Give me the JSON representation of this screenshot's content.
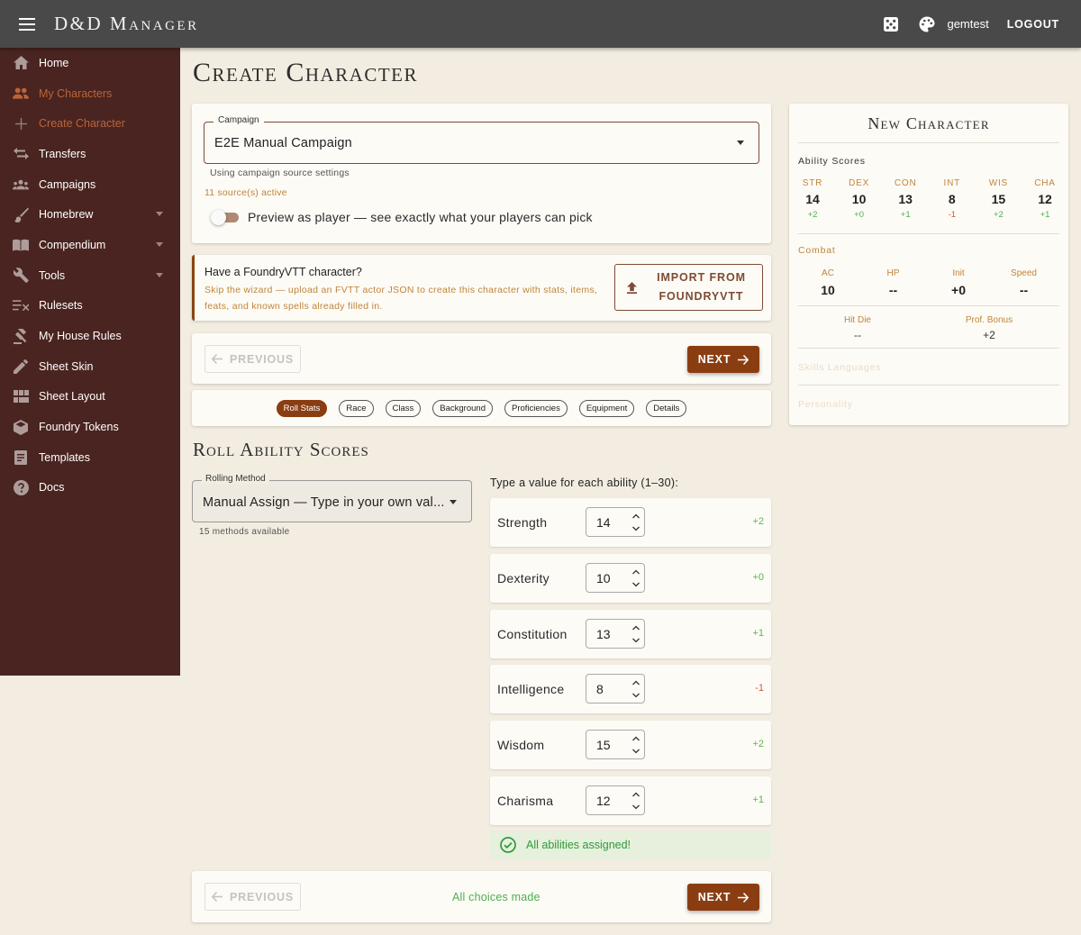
{
  "app": {
    "title": "D&D Manager",
    "user": "gemtest",
    "logout": "LOGOUT"
  },
  "icons": {
    "menu": "hamburger-icon",
    "dice": "dice-icon",
    "palette": "palette-icon"
  },
  "colors": {
    "accent": "#8b3d12",
    "sidebar": "#4a2420",
    "topbar": "#494949",
    "orange_text": "#c0853a",
    "positive": "#4caf50",
    "negative": "#c95a3a"
  },
  "sidebar": {
    "items": [
      {
        "label": "Home",
        "icon": "home-icon"
      },
      {
        "label": "My Characters",
        "icon": "people-icon"
      },
      {
        "label": "Create Character",
        "icon": "plus-icon"
      },
      {
        "label": "Transfers",
        "icon": "swap-icon"
      },
      {
        "label": "Campaigns",
        "icon": "group-icon"
      },
      {
        "label": "Homebrew",
        "icon": "brush-icon"
      },
      {
        "label": "Compendium",
        "icon": "book-icon"
      },
      {
        "label": "Tools",
        "icon": "wrench-icon"
      },
      {
        "label": "Rulesets",
        "icon": "rules-icon"
      },
      {
        "label": "My House Rules",
        "icon": "gavel-icon"
      },
      {
        "label": "Sheet Skin",
        "icon": "pen-icon"
      },
      {
        "label": "Sheet Layout",
        "icon": "layout-icon"
      },
      {
        "label": "Foundry Tokens",
        "icon": "cube-icon"
      },
      {
        "label": "Templates",
        "icon": "document-icon"
      },
      {
        "label": "Docs",
        "icon": "help-icon"
      }
    ]
  },
  "page": {
    "title": "Create Character"
  },
  "campaign": {
    "legend": "Campaign",
    "value": "E2E Manual Campaign",
    "helper": "Using campaign source settings",
    "sources": "11 source(s) active",
    "preview_label": "Preview as player — see exactly what your players can pick"
  },
  "foundry": {
    "title": "Have a FoundryVTT character?",
    "desc": "Skip the wizard — upload an FVTT actor JSON to create this character with stats, items, feats, and known spells already filled in.",
    "button": "IMPORT FROM FOUNDRYVTT"
  },
  "nav": {
    "previous": "PREVIOUS",
    "next": "NEXT",
    "choices_made": "All choices made"
  },
  "steps": [
    "Roll Stats",
    "Race",
    "Class",
    "Background",
    "Proficiencies",
    "Equipment",
    "Details"
  ],
  "active_step": "Roll Stats",
  "roll": {
    "title": "Roll Ability Scores",
    "method_legend": "Rolling Method",
    "method_value": "Manual Assign — Type in your own val...",
    "methods_count": "15 methods available",
    "prompt": "Type a value for each ability (1–30):",
    "abilities": [
      {
        "name": "Strength",
        "value": "14",
        "mod": "+2"
      },
      {
        "name": "Dexterity",
        "value": "10",
        "mod": "+0"
      },
      {
        "name": "Constitution",
        "value": "13",
        "mod": "+1"
      },
      {
        "name": "Intelligence",
        "value": "8",
        "mod": "-1"
      },
      {
        "name": "Wisdom",
        "value": "15",
        "mod": "+2"
      },
      {
        "name": "Charisma",
        "value": "12",
        "mod": "+1"
      }
    ],
    "assigned": "All abilities assigned!"
  },
  "summary": {
    "title": "New Character",
    "ability_label": "Ability Scores",
    "abilities": [
      {
        "abbr": "STR",
        "score": "14",
        "mod": "+2"
      },
      {
        "abbr": "DEX",
        "score": "10",
        "mod": "+0"
      },
      {
        "abbr": "CON",
        "score": "13",
        "mod": "+1"
      },
      {
        "abbr": "INT",
        "score": "8",
        "mod": "-1"
      },
      {
        "abbr": "WIS",
        "score": "15",
        "mod": "+2"
      },
      {
        "abbr": "CHA",
        "score": "12",
        "mod": "+1"
      }
    ],
    "combat_label": "Combat",
    "combat": [
      {
        "label": "AC",
        "value": "10"
      },
      {
        "label": "HP",
        "value": "--"
      },
      {
        "label": "Init",
        "value": "+0"
      },
      {
        "label": "Speed",
        "value": "--"
      }
    ],
    "hit_die": {
      "label": "Hit Die",
      "value": "--"
    },
    "prof_bonus": {
      "label": "Prof. Bonus",
      "value": "+2"
    },
    "skills_label": "Skills Languages",
    "personality_label": "Personality"
  }
}
